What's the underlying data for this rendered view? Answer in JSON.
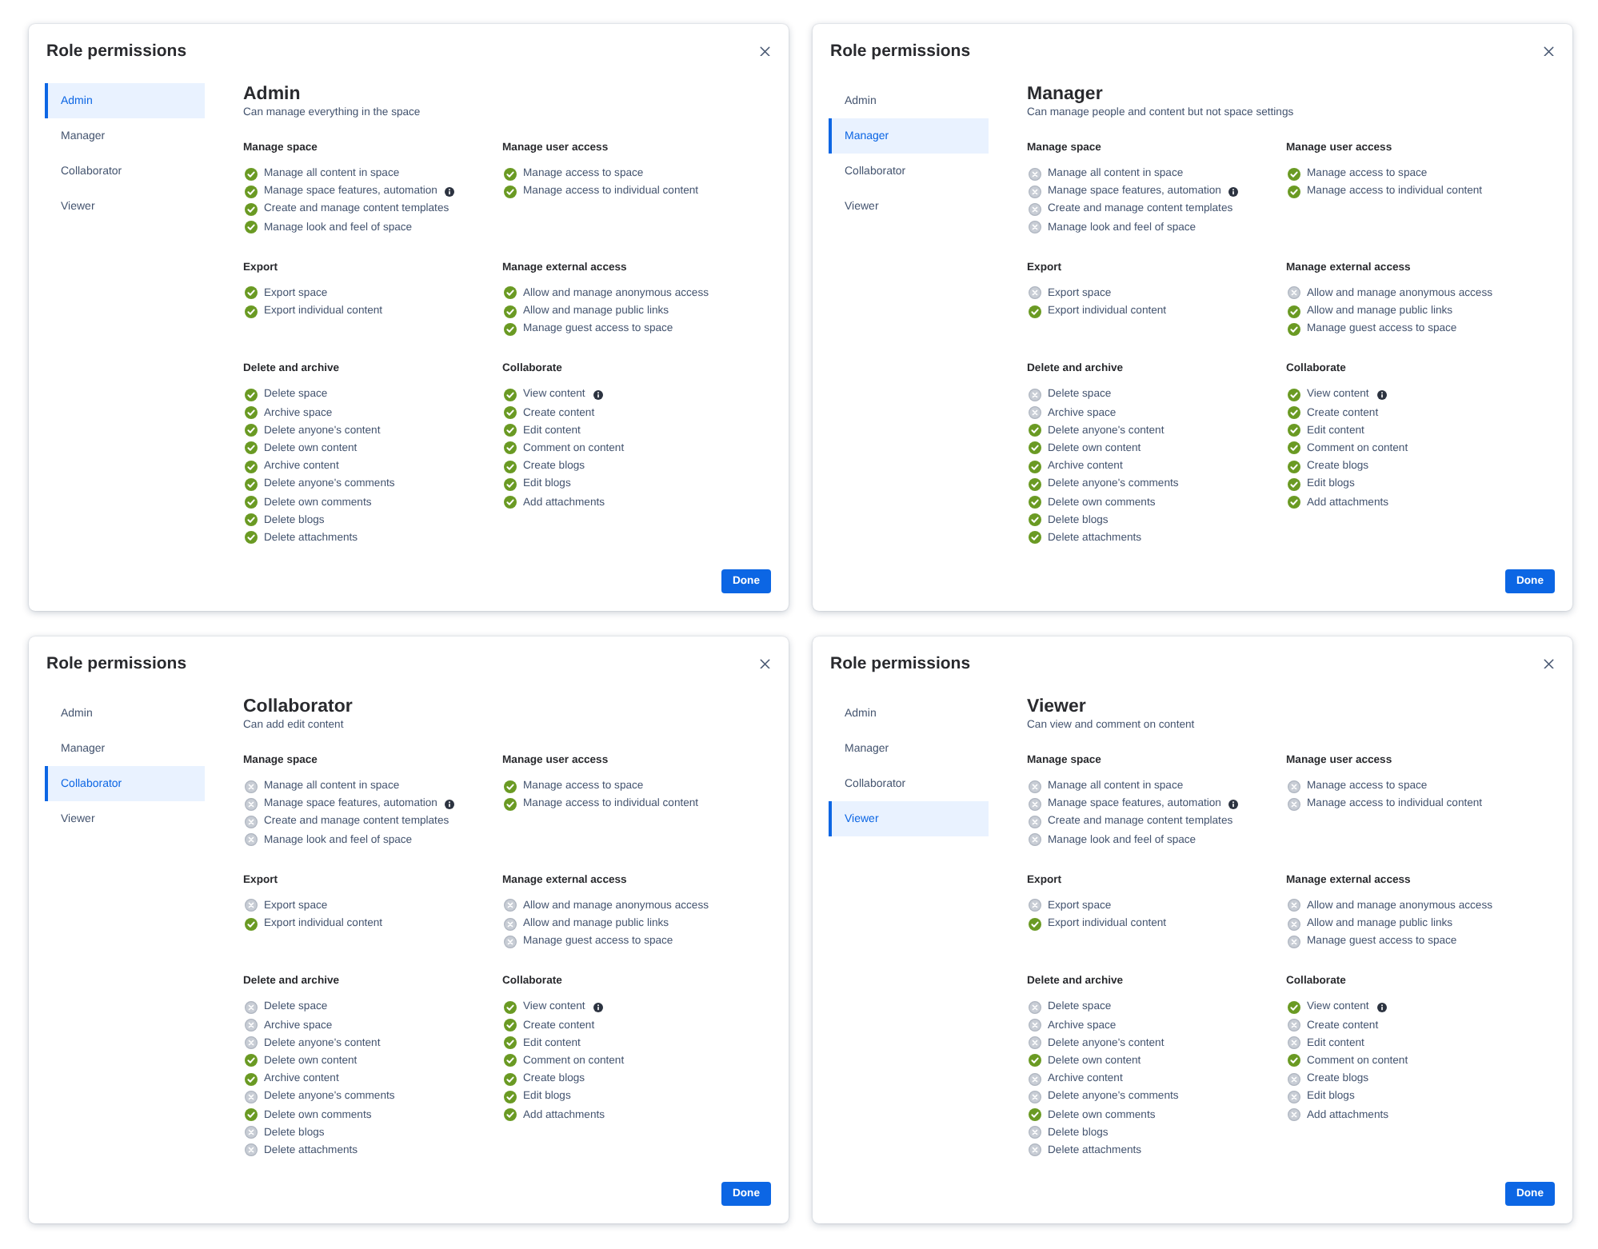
{
  "dialogs": [
    {
      "title": "Role permissions",
      "roles": [
        {
          "label": "Admin",
          "selected": true
        },
        {
          "label": "Manager",
          "selected": false
        },
        {
          "label": "Collaborator",
          "selected": false
        },
        {
          "label": "Viewer",
          "selected": false
        }
      ],
      "role_heading": "Admin",
      "role_description": "Can manage everything in the space",
      "sections": [
        {
          "heading": "Manage space",
          "permissions": [
            {
              "label": "Manage all content in space",
              "allowed": true,
              "info": false
            },
            {
              "label": "Manage space features, automation",
              "allowed": true,
              "info": true
            },
            {
              "label": "Create and manage content templates",
              "allowed": true,
              "info": false
            },
            {
              "label": "Manage look and feel of space",
              "allowed": true,
              "info": false
            }
          ]
        },
        {
          "heading": "Manage user access",
          "permissions": [
            {
              "label": "Manage access to space",
              "allowed": true,
              "info": false
            },
            {
              "label": "Manage access to individual content",
              "allowed": true,
              "info": false
            }
          ]
        },
        {
          "heading": "Export",
          "permissions": [
            {
              "label": "Export space",
              "allowed": true,
              "info": false
            },
            {
              "label": "Export individual content",
              "allowed": true,
              "info": false
            }
          ]
        },
        {
          "heading": "Manage external access",
          "permissions": [
            {
              "label": "Allow and manage anonymous access",
              "allowed": true,
              "info": false
            },
            {
              "label": "Allow and manage public links",
              "allowed": true,
              "info": false
            },
            {
              "label": "Manage guest access to space",
              "allowed": true,
              "info": false
            }
          ]
        },
        {
          "heading": "Delete and archive",
          "permissions": [
            {
              "label": "Delete space",
              "allowed": true,
              "info": false
            },
            {
              "label": "Archive space",
              "allowed": true,
              "info": false
            },
            {
              "label": "Delete anyone's content",
              "allowed": true,
              "info": false
            },
            {
              "label": "Delete own content",
              "allowed": true,
              "info": false
            },
            {
              "label": "Archive content",
              "allowed": true,
              "info": false
            },
            {
              "label": "Delete anyone's comments",
              "allowed": true,
              "info": false
            },
            {
              "label": "Delete own comments",
              "allowed": true,
              "info": false
            },
            {
              "label": "Delete blogs",
              "allowed": true,
              "info": false
            },
            {
              "label": "Delete attachments",
              "allowed": true,
              "info": false
            }
          ]
        },
        {
          "heading": "Collaborate",
          "permissions": [
            {
              "label": "View content",
              "allowed": true,
              "info": true
            },
            {
              "label": "Create content",
              "allowed": true,
              "info": false
            },
            {
              "label": "Edit content",
              "allowed": true,
              "info": false
            },
            {
              "label": "Comment on content",
              "allowed": true,
              "info": false
            },
            {
              "label": "Create blogs",
              "allowed": true,
              "info": false
            },
            {
              "label": "Edit blogs",
              "allowed": true,
              "info": false
            },
            {
              "label": "Add attachments",
              "allowed": true,
              "info": false
            }
          ]
        }
      ],
      "done_button": "Done"
    },
    {
      "title": "Role permissions",
      "roles": [
        {
          "label": "Admin",
          "selected": false
        },
        {
          "label": "Manager",
          "selected": true
        },
        {
          "label": "Collaborator",
          "selected": false
        },
        {
          "label": "Viewer",
          "selected": false
        }
      ],
      "role_heading": "Manager",
      "role_description": "Can manage people and content but not space settings",
      "sections": [
        {
          "heading": "Manage space",
          "permissions": [
            {
              "label": "Manage all content in space",
              "allowed": false,
              "info": false
            },
            {
              "label": "Manage space features, automation",
              "allowed": false,
              "info": true
            },
            {
              "label": "Create and manage content templates",
              "allowed": false,
              "info": false
            },
            {
              "label": "Manage look and feel of space",
              "allowed": false,
              "info": false
            }
          ]
        },
        {
          "heading": "Manage user access",
          "permissions": [
            {
              "label": "Manage access to space",
              "allowed": true,
              "info": false
            },
            {
              "label": "Manage access to individual content",
              "allowed": true,
              "info": false
            }
          ]
        },
        {
          "heading": "Export",
          "permissions": [
            {
              "label": "Export space",
              "allowed": false,
              "info": false
            },
            {
              "label": "Export individual content",
              "allowed": true,
              "info": false
            }
          ]
        },
        {
          "heading": "Manage external access",
          "permissions": [
            {
              "label": "Allow and manage anonymous access",
              "allowed": false,
              "info": false
            },
            {
              "label": "Allow and manage public links",
              "allowed": true,
              "info": false
            },
            {
              "label": "Manage guest access to space",
              "allowed": true,
              "info": false
            }
          ]
        },
        {
          "heading": "Delete and archive",
          "permissions": [
            {
              "label": "Delete space",
              "allowed": false,
              "info": false
            },
            {
              "label": "Archive space",
              "allowed": false,
              "info": false
            },
            {
              "label": "Delete anyone's content",
              "allowed": true,
              "info": false
            },
            {
              "label": "Delete own content",
              "allowed": true,
              "info": false
            },
            {
              "label": "Archive content",
              "allowed": true,
              "info": false
            },
            {
              "label": "Delete anyone's comments",
              "allowed": true,
              "info": false
            },
            {
              "label": "Delete own comments",
              "allowed": true,
              "info": false
            },
            {
              "label": "Delete blogs",
              "allowed": true,
              "info": false
            },
            {
              "label": "Delete attachments",
              "allowed": true,
              "info": false
            }
          ]
        },
        {
          "heading": "Collaborate",
          "permissions": [
            {
              "label": "View content",
              "allowed": true,
              "info": true
            },
            {
              "label": "Create content",
              "allowed": true,
              "info": false
            },
            {
              "label": "Edit content",
              "allowed": true,
              "info": false
            },
            {
              "label": "Comment on content",
              "allowed": true,
              "info": false
            },
            {
              "label": "Create blogs",
              "allowed": true,
              "info": false
            },
            {
              "label": "Edit blogs",
              "allowed": true,
              "info": false
            },
            {
              "label": "Add attachments",
              "allowed": true,
              "info": false
            }
          ]
        }
      ],
      "done_button": "Done"
    },
    {
      "title": "Role permissions",
      "roles": [
        {
          "label": "Admin",
          "selected": false
        },
        {
          "label": "Manager",
          "selected": false
        },
        {
          "label": "Collaborator",
          "selected": true
        },
        {
          "label": "Viewer",
          "selected": false
        }
      ],
      "role_heading": "Collaborator",
      "role_description": "Can add edit content",
      "sections": [
        {
          "heading": "Manage space",
          "permissions": [
            {
              "label": "Manage all content in space",
              "allowed": false,
              "info": false
            },
            {
              "label": "Manage space features, automation",
              "allowed": false,
              "info": true
            },
            {
              "label": "Create and manage content templates",
              "allowed": false,
              "info": false
            },
            {
              "label": "Manage look and feel of space",
              "allowed": false,
              "info": false
            }
          ]
        },
        {
          "heading": "Manage user access",
          "permissions": [
            {
              "label": "Manage access to space",
              "allowed": true,
              "info": false
            },
            {
              "label": "Manage access to individual content",
              "allowed": true,
              "info": false
            }
          ]
        },
        {
          "heading": "Export",
          "permissions": [
            {
              "label": "Export space",
              "allowed": false,
              "info": false
            },
            {
              "label": "Export individual content",
              "allowed": true,
              "info": false
            }
          ]
        },
        {
          "heading": "Manage external access",
          "permissions": [
            {
              "label": "Allow and manage anonymous access",
              "allowed": false,
              "info": false
            },
            {
              "label": "Allow and manage public links",
              "allowed": false,
              "info": false
            },
            {
              "label": "Manage guest access to space",
              "allowed": false,
              "info": false
            }
          ]
        },
        {
          "heading": "Delete and archive",
          "permissions": [
            {
              "label": "Delete space",
              "allowed": false,
              "info": false
            },
            {
              "label": "Archive space",
              "allowed": false,
              "info": false
            },
            {
              "label": "Delete anyone's content",
              "allowed": false,
              "info": false
            },
            {
              "label": "Delete own content",
              "allowed": true,
              "info": false
            },
            {
              "label": "Archive content",
              "allowed": true,
              "info": false
            },
            {
              "label": "Delete anyone's comments",
              "allowed": false,
              "info": false
            },
            {
              "label": "Delete own comments",
              "allowed": true,
              "info": false
            },
            {
              "label": "Delete blogs",
              "allowed": false,
              "info": false
            },
            {
              "label": "Delete attachments",
              "allowed": false,
              "info": false
            }
          ]
        },
        {
          "heading": "Collaborate",
          "permissions": [
            {
              "label": "View content",
              "allowed": true,
              "info": true
            },
            {
              "label": "Create content",
              "allowed": true,
              "info": false
            },
            {
              "label": "Edit content",
              "allowed": true,
              "info": false
            },
            {
              "label": "Comment on content",
              "allowed": true,
              "info": false
            },
            {
              "label": "Create blogs",
              "allowed": true,
              "info": false
            },
            {
              "label": "Edit blogs",
              "allowed": true,
              "info": false
            },
            {
              "label": "Add attachments",
              "allowed": true,
              "info": false
            }
          ]
        }
      ],
      "done_button": "Done"
    },
    {
      "title": "Role permissions",
      "roles": [
        {
          "label": "Admin",
          "selected": false
        },
        {
          "label": "Manager",
          "selected": false
        },
        {
          "label": "Collaborator",
          "selected": false
        },
        {
          "label": "Viewer",
          "selected": true
        }
      ],
      "role_heading": "Viewer",
      "role_description": "Can view and comment on content",
      "sections": [
        {
          "heading": "Manage space",
          "permissions": [
            {
              "label": "Manage all content in space",
              "allowed": false,
              "info": false
            },
            {
              "label": "Manage space features, automation",
              "allowed": false,
              "info": true
            },
            {
              "label": "Create and manage content templates",
              "allowed": false,
              "info": false
            },
            {
              "label": "Manage look and feel of space",
              "allowed": false,
              "info": false
            }
          ]
        },
        {
          "heading": "Manage user access",
          "permissions": [
            {
              "label": "Manage access to space",
              "allowed": false,
              "info": false
            },
            {
              "label": "Manage access to individual content",
              "allowed": false,
              "info": false
            }
          ]
        },
        {
          "heading": "Export",
          "permissions": [
            {
              "label": "Export space",
              "allowed": false,
              "info": false
            },
            {
              "label": "Export individual content",
              "allowed": true,
              "info": false
            }
          ]
        },
        {
          "heading": "Manage external access",
          "permissions": [
            {
              "label": "Allow and manage anonymous access",
              "allowed": false,
              "info": false
            },
            {
              "label": "Allow and manage public links",
              "allowed": false,
              "info": false
            },
            {
              "label": "Manage guest access to space",
              "allowed": false,
              "info": false
            }
          ]
        },
        {
          "heading": "Delete and archive",
          "permissions": [
            {
              "label": "Delete space",
              "allowed": false,
              "info": false
            },
            {
              "label": "Archive space",
              "allowed": false,
              "info": false
            },
            {
              "label": "Delete anyone's content",
              "allowed": false,
              "info": false
            },
            {
              "label": "Delete own content",
              "allowed": true,
              "info": false
            },
            {
              "label": "Archive content",
              "allowed": false,
              "info": false
            },
            {
              "label": "Delete anyone's comments",
              "allowed": false,
              "info": false
            },
            {
              "label": "Delete own comments",
              "allowed": true,
              "info": false
            },
            {
              "label": "Delete blogs",
              "allowed": false,
              "info": false
            },
            {
              "label": "Delete attachments",
              "allowed": false,
              "info": false
            }
          ]
        },
        {
          "heading": "Collaborate",
          "permissions": [
            {
              "label": "View content",
              "allowed": true,
              "info": true
            },
            {
              "label": "Create content",
              "allowed": false,
              "info": false
            },
            {
              "label": "Edit content",
              "allowed": false,
              "info": false
            },
            {
              "label": "Comment on content",
              "allowed": true,
              "info": false
            },
            {
              "label": "Create blogs",
              "allowed": false,
              "info": false
            },
            {
              "label": "Edit blogs",
              "allowed": false,
              "info": false
            },
            {
              "label": "Add attachments",
              "allowed": false,
              "info": false
            }
          ]
        }
      ],
      "done_button": "Done"
    }
  ]
}
